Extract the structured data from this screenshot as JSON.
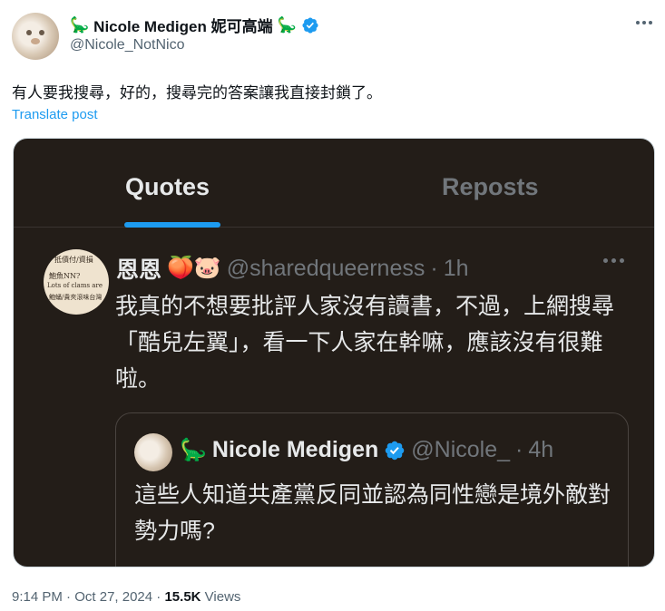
{
  "author": {
    "display_name": "Nicole Medigen 妮可高端",
    "handle": "@Nicole_NotNico",
    "emoji": "🦕",
    "verified": true,
    "avatar_icon": "hamster-avatar"
  },
  "post": {
    "text": "有人要我搜尋，好的，搜尋完的答案讓我直接封鎖了。",
    "translate_label": "Translate post"
  },
  "media": {
    "tabs": [
      {
        "label": "Quotes",
        "active": true
      },
      {
        "label": "Reposts",
        "active": false
      }
    ],
    "quote": {
      "name": "恩恩",
      "emojis": "🍑🐷",
      "handle": "@sharedqueerness",
      "separator": "·",
      "time": "1h",
      "text": "我真的不想要批評人家沒有讀書，不過，上網搜尋「酷兒左翼」，看一下人家在幹嘛，應該沒有很難啦。",
      "avatar_lines": [
        "抵債付/資損",
        "鮑魚NN?",
        "Lots of clams are",
        "鮑蛹/貴夾滾味台灣"
      ],
      "embedded": {
        "name": "Nicole Medigen",
        "emoji": "🦕",
        "handle": "@Nicole_",
        "separator": "·",
        "time": "4h",
        "text": "這些人知道共產黨反同並認為同性戀是境外敵對勢力嗎?"
      }
    }
  },
  "footer": {
    "time": "9:14 PM",
    "dot1": "·",
    "date": "Oct 27, 2024",
    "dot2": "·",
    "views_count": "15.5K",
    "views_label": "Views"
  },
  "colors": {
    "accent": "#1d9bf0",
    "dark_bg": "#231d18",
    "secondary_text": "#536471"
  }
}
